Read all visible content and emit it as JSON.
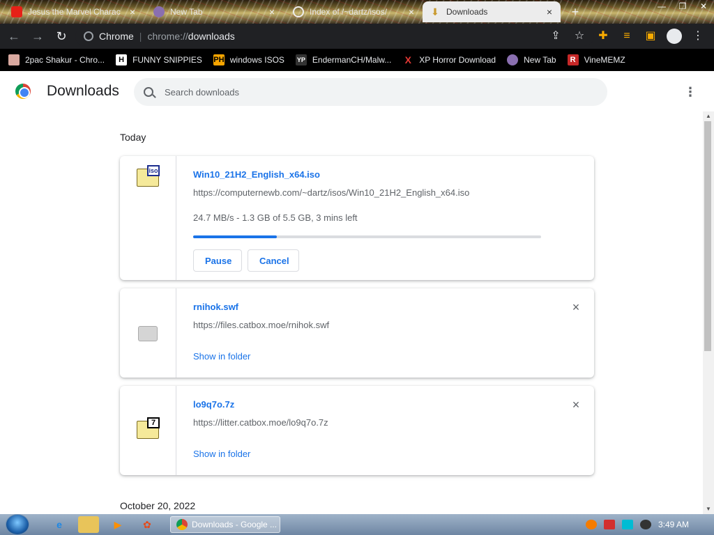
{
  "tabs": [
    {
      "title": "Jesus the Marvel Charac",
      "icon": "youtube-icon"
    },
    {
      "title": "New Tab",
      "icon": "newtab-icon"
    },
    {
      "title": "Index of /~dartz/isos/",
      "icon": "globe-icon"
    },
    {
      "title": "Downloads",
      "icon": "download-icon",
      "active": true
    }
  ],
  "omnibox": {
    "site": "Chrome",
    "scheme": "chrome://",
    "path": "downloads"
  },
  "bookmarks": [
    {
      "label": "2pac Shakur - Chro...",
      "icon": "bookmark-icon"
    },
    {
      "label": "FUNNY SNIPPIES",
      "badge": "H"
    },
    {
      "label": "windows ISOS",
      "badge": "PH"
    },
    {
      "label": "EndermanCH/Malw...",
      "badge": "YP"
    },
    {
      "label": "XP Horror Download",
      "badge": "X"
    },
    {
      "label": "New Tab",
      "icon": "newtab-icon"
    },
    {
      "label": "VineMEMZ",
      "badge": "R"
    }
  ],
  "page": {
    "title": "Downloads",
    "search_placeholder": "Search downloads"
  },
  "sections": {
    "today": "Today",
    "older": "October 20, 2022"
  },
  "downloads": [
    {
      "name": "Win10_21H2_English_x64.iso",
      "url": "https://computernewb.com/~dartz/isos/Win10_21H2_English_x64.iso",
      "status": "24.7 MB/s - 1.3 GB of 5.5 GB, 3 mins left",
      "progress": 0.24,
      "pause": "Pause",
      "cancel": "Cancel",
      "badge": "iso"
    },
    {
      "name": "rnihok.swf",
      "url": "https://files.catbox.moe/rnihok.swf",
      "action": "Show in folder"
    },
    {
      "name": "lo9q7o.7z",
      "url": "https://litter.catbox.moe/lo9q7o.7z",
      "action": "Show in folder",
      "badge": "7"
    }
  ],
  "taskbar": {
    "task": "Downloads - Google ...",
    "clock": "3:49 AM"
  },
  "colors": {
    "accent": "#1a73e8",
    "toolbar": "#202124"
  }
}
